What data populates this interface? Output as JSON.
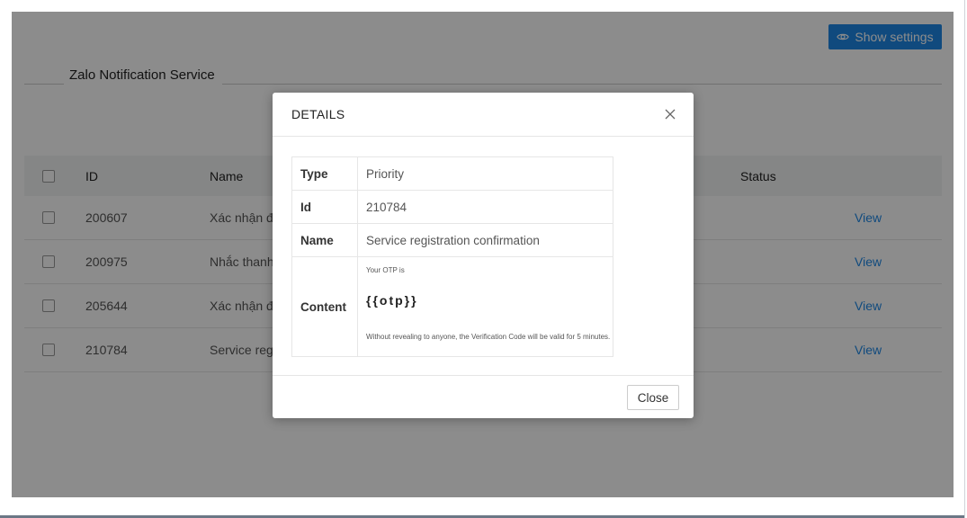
{
  "header": {
    "show_settings_label": "Show settings"
  },
  "section": {
    "title": "Zalo Notification Service"
  },
  "table": {
    "columns": {
      "id": "ID",
      "name": "Name",
      "status": "Status"
    },
    "rows": [
      {
        "id": "200607",
        "name": "Xác nhận đơ",
        "action": "View"
      },
      {
        "id": "200975",
        "name": "Nhắc thanh t",
        "action": "View"
      },
      {
        "id": "205644",
        "name": "Xác nhận đã",
        "action": "View"
      },
      {
        "id": "210784",
        "name": "Service regis",
        "action": "View"
      }
    ]
  },
  "modal": {
    "title": "DETAILS",
    "fields": {
      "type_label": "Type",
      "type_value": "Priority",
      "id_label": "Id",
      "id_value": "210784",
      "name_label": "Name",
      "name_value": "Service registration confirmation",
      "content_label": "Content",
      "content_line1": "Your OTP is",
      "content_variable": "{{otp}}",
      "content_line2": "Without revealing to anyone, the Verification Code will be valid for 5 minutes."
    },
    "close_label": "Close"
  },
  "colors": {
    "accent": "#1e88e5",
    "overlay": "rgba(0,0,0,0.45)"
  }
}
